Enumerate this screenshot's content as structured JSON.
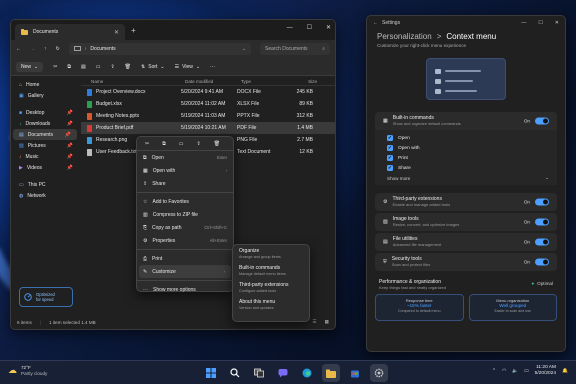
{
  "explorer": {
    "tab_title": "Documents",
    "address": "Documents",
    "search_placeholder": "Search Documents",
    "cmd": {
      "new": "New",
      "sort": "Sort",
      "view": "View",
      "more": "···"
    },
    "sidebar": [
      {
        "label": "Home",
        "icon": "home-icon"
      },
      {
        "label": "Gallery",
        "icon": "gallery-icon"
      },
      {
        "label": "Desktop",
        "icon": "desktop-icon"
      },
      {
        "label": "Downloads",
        "icon": "downloads-icon"
      },
      {
        "label": "Documents",
        "icon": "documents-icon"
      },
      {
        "label": "Pictures",
        "icon": "pictures-icon"
      },
      {
        "label": "Music",
        "icon": "music-icon"
      },
      {
        "label": "Videos",
        "icon": "videos-icon"
      },
      {
        "label": "This PC",
        "icon": "pc-icon"
      },
      {
        "label": "Network",
        "icon": "network-icon"
      }
    ],
    "promo": {
      "line1": "Optimized",
      "line2": "for speed"
    },
    "columns": [
      "Name",
      "Date modified",
      "Type",
      "Size"
    ],
    "files": [
      {
        "name": "Project Overview.docx",
        "date": "5/20/2024 9:41 AM",
        "type": "DOCX File",
        "size": "245 KB",
        "color": "#2f7bd8"
      },
      {
        "name": "Budget.xlsx",
        "date": "5/20/2024 11:02 AM",
        "type": "XLSX File",
        "size": "89 KB",
        "color": "#2aa050"
      },
      {
        "name": "Meeting Notes.pptx",
        "date": "5/19/2024 11:03 AM",
        "type": "PPTX File",
        "size": "312 KB",
        "color": "#d8572f"
      },
      {
        "name": "Product Brief.pdf",
        "date": "5/19/2024 10:21 AM",
        "type": "PDF File",
        "size": "1.4 MB",
        "color": "#d83a3a"
      },
      {
        "name": "Research.png",
        "date": "",
        "type": "PNG File",
        "size": "2.7 MB",
        "color": "#3a9ad8"
      },
      {
        "name": "User Feedback.txt",
        "date": "",
        "type": "Text Document",
        "size": "12 KB",
        "color": "#bdbdbd"
      }
    ],
    "status": {
      "count": "6 items",
      "selected": "1 item selected  1.4 MB"
    }
  },
  "context_menu": {
    "items": [
      {
        "label": "Open",
        "shortcut": "Enter",
        "icon": "open-icon"
      },
      {
        "label": "Open with",
        "shortcut": "",
        "icon": "open-with-icon",
        "arrow": true
      },
      {
        "label": "Share",
        "shortcut": "",
        "icon": "share-icon"
      },
      {
        "label": "Add to Favorites",
        "shortcut": "",
        "icon": "star-icon"
      },
      {
        "label": "Compress to ZIP file",
        "shortcut": "",
        "icon": "zip-icon"
      },
      {
        "label": "Copy as path",
        "shortcut": "Ctrl+Shift+C",
        "icon": "copy-path-icon"
      },
      {
        "label": "Properties",
        "shortcut": "Alt+Enter",
        "icon": "properties-icon"
      },
      {
        "label": "Print",
        "shortcut": "",
        "icon": "print-icon"
      },
      {
        "label": "Customize",
        "shortcut": "",
        "icon": "customize-icon",
        "arrow": true
      },
      {
        "label": "Show more options",
        "shortcut": "",
        "icon": "more-options-icon"
      }
    ],
    "submenu": [
      {
        "title": "Organize",
        "desc": "Arrange and group items"
      },
      {
        "title": "Built-in commands",
        "desc": "Manage default menu items"
      },
      {
        "title": "Third-party extensions",
        "desc": "Configure added tools"
      },
      {
        "title": "About this menu",
        "desc": "Version and updates"
      }
    ]
  },
  "settings": {
    "window_title": "Settings",
    "crumb_parent": "Personalization",
    "crumb_sep": ">",
    "crumb_current": "Context menu",
    "subtitle": "Customize your right-click menu experience",
    "builtin": {
      "title": "Built-in commands",
      "desc": "Show and organize default commands",
      "state": "On"
    },
    "checks": [
      "Open",
      "Open with",
      "Print",
      "Share"
    ],
    "show_more": "Show more",
    "third_party": {
      "title": "Third-party extensions",
      "desc": "Enable and manage added tools",
      "state": "On"
    },
    "extensions": [
      {
        "title": "Image tools",
        "desc": "Resize, convert, and optimize images",
        "state": "On"
      },
      {
        "title": "File utilities",
        "desc": "Advanced file management",
        "state": "On"
      },
      {
        "title": "Security tools",
        "desc": "Scan and protect files",
        "state": "On"
      }
    ],
    "perf": {
      "title": "Performance & organization",
      "desc": "Keep things fast and neatly organized",
      "badge": "Optimal"
    },
    "tiles": [
      {
        "label": "Response time",
        "value": "~15% faster",
        "desc": "Compared to default menu"
      },
      {
        "label": "Menu organization",
        "value": "Well grouped",
        "desc": "Easier to scan and use"
      }
    ],
    "accent": "#4ca0ff"
  },
  "taskbar": {
    "temp": "72°F",
    "condition": "Partly cloudy",
    "time": "11:20 AM",
    "date": "5/20/2024"
  }
}
